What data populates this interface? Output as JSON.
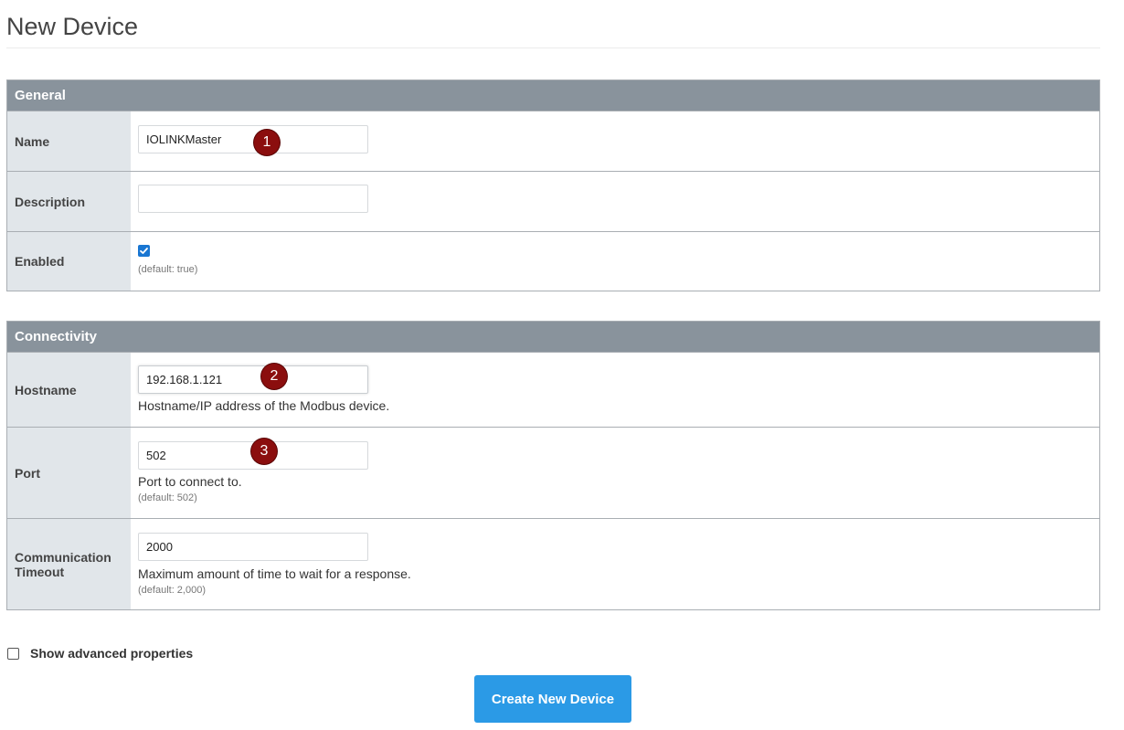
{
  "page": {
    "title": "New Device"
  },
  "general": {
    "header": "General",
    "name": {
      "label": "Name",
      "value": "IOLINKMaster",
      "badge": "1"
    },
    "description": {
      "label": "Description",
      "value": ""
    },
    "enabled": {
      "label": "Enabled",
      "checked": true,
      "default_note": "(default: true)"
    }
  },
  "connectivity": {
    "header": "Connectivity",
    "hostname": {
      "label": "Hostname",
      "value": "192.168.1.121",
      "help": "Hostname/IP address of the Modbus device.",
      "badge": "2"
    },
    "port": {
      "label": "Port",
      "value": "502",
      "help": "Port to connect to.",
      "default_note": "(default: 502)",
      "badge": "3"
    },
    "timeout": {
      "label_line1": "Communication",
      "label_line2": "Timeout",
      "value": "2000",
      "help": "Maximum amount of time to wait for a response.",
      "default_note": "(default: 2,000)"
    }
  },
  "advanced": {
    "label": "Show advanced properties",
    "checked": false
  },
  "actions": {
    "create_label": "Create New Device"
  },
  "colors": {
    "header_bg": "#89939c",
    "label_bg": "#e1e6ea",
    "primary_button": "#2b9ae6",
    "badge": "#8b0e0e",
    "checkbox": "#1976d2"
  }
}
